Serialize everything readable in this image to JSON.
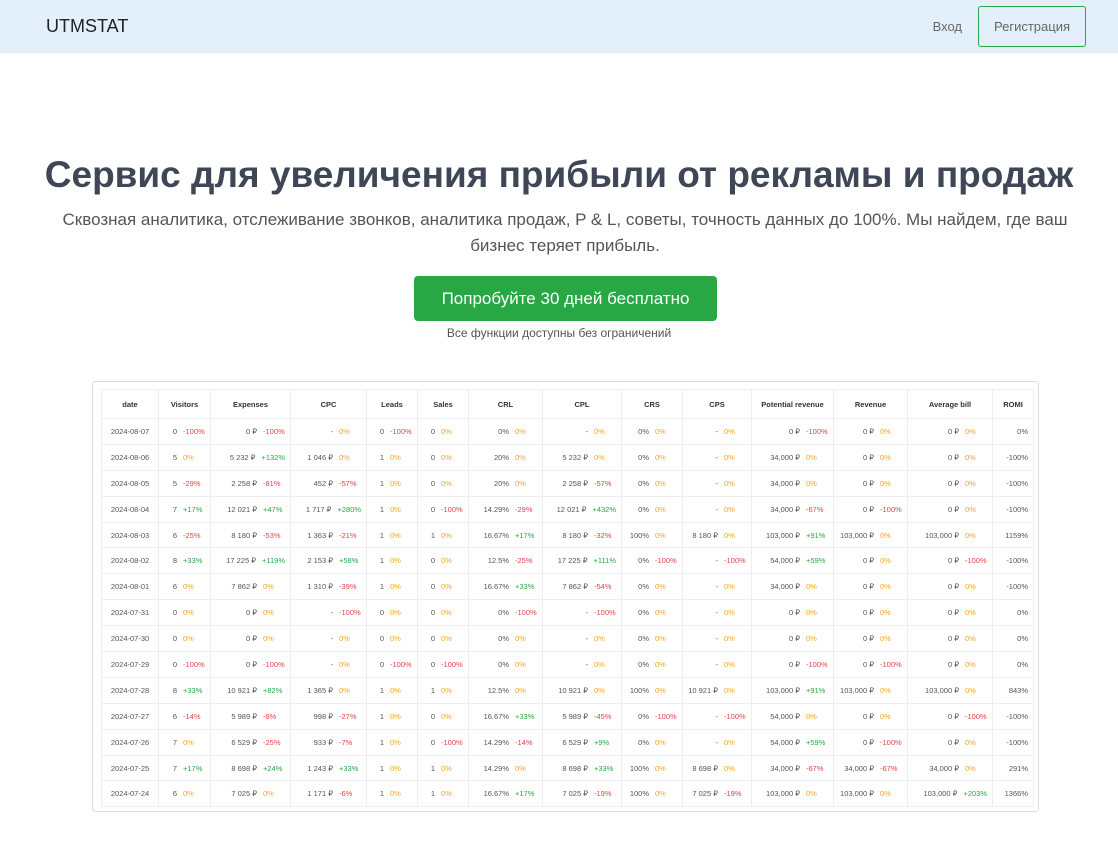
{
  "nav": {
    "brand": "UTMSTAT",
    "login": "Вход",
    "register": "Регистрация"
  },
  "hero": {
    "title": "Сервис для увеличения прибыли от рекламы и продаж",
    "subtitle": "Сквозная аналитика, отслеживание звонков, аналитика продаж, P & L, советы, точность данных до 100%. Мы найдем, где ваш бизнес теряет прибыль.",
    "cta": "Попробуйте 30 дней бесплатно",
    "note": "Все функции доступны без ограничений"
  },
  "colors": {
    "positive": "#28a745",
    "negative": "#e04545",
    "neutral": "#f5a623"
  },
  "table": {
    "columns": [
      "date",
      "Visitors",
      "Expenses",
      "CPC",
      "Leads",
      "Sales",
      "CRL",
      "CPL",
      "CRS",
      "CPS",
      "Potential revenue",
      "Revenue",
      "Average bill",
      "ROMI"
    ],
    "rows": [
      [
        "2024-08-07",
        [
          "0",
          "-100%"
        ],
        [
          "0 ₽",
          "-100%"
        ],
        [
          "-",
          "0%"
        ],
        [
          "0",
          "-100%"
        ],
        [
          "0",
          "0%"
        ],
        [
          "0%",
          "0%"
        ],
        [
          "-",
          "0%"
        ],
        [
          "0%",
          "0%"
        ],
        [
          "-",
          "0%"
        ],
        [
          "0 ₽",
          "-100%"
        ],
        [
          "0 ₽",
          "0%"
        ],
        [
          "0 ₽",
          "0%"
        ],
        "0%"
      ],
      [
        "2024-08-06",
        [
          "5",
          "0%"
        ],
        [
          "5 232 ₽",
          "+132%"
        ],
        [
          "1 046 ₽",
          "0%"
        ],
        [
          "1",
          "0%"
        ],
        [
          "0",
          "0%"
        ],
        [
          "20%",
          "0%"
        ],
        [
          "5 232 ₽",
          "0%"
        ],
        [
          "0%",
          "0%"
        ],
        [
          "-",
          "0%"
        ],
        [
          "34,000 ₽",
          "0%"
        ],
        [
          "0 ₽",
          "0%"
        ],
        [
          "0 ₽",
          "0%"
        ],
        "-100%"
      ],
      [
        "2024-08-05",
        [
          "5",
          "-29%"
        ],
        [
          "2 258 ₽",
          "-81%"
        ],
        [
          "452 ₽",
          "-57%"
        ],
        [
          "1",
          "0%"
        ],
        [
          "0",
          "0%"
        ],
        [
          "20%",
          "0%"
        ],
        [
          "2 258 ₽",
          "-57%"
        ],
        [
          "0%",
          "0%"
        ],
        [
          "-",
          "0%"
        ],
        [
          "34,000 ₽",
          "0%"
        ],
        [
          "0 ₽",
          "0%"
        ],
        [
          "0 ₽",
          "0%"
        ],
        "-100%"
      ],
      [
        "2024-08-04",
        [
          "7",
          "+17%"
        ],
        [
          "12 021 ₽",
          "+47%"
        ],
        [
          "1 717 ₽",
          "+280%"
        ],
        [
          "1",
          "0%"
        ],
        [
          "0",
          "-100%"
        ],
        [
          "14.29%",
          "-29%"
        ],
        [
          "12 021 ₽",
          "+432%"
        ],
        [
          "0%",
          "0%"
        ],
        [
          "-",
          "0%"
        ],
        [
          "34,000 ₽",
          "-67%"
        ],
        [
          "0 ₽",
          "-100%"
        ],
        [
          "0 ₽",
          "0%"
        ],
        "-100%"
      ],
      [
        "2024-08-03",
        [
          "6",
          "-25%"
        ],
        [
          "8 180 ₽",
          "-53%"
        ],
        [
          "1 363 ₽",
          "-21%"
        ],
        [
          "1",
          "0%"
        ],
        [
          "1",
          "0%"
        ],
        [
          "16.67%",
          "+17%"
        ],
        [
          "8 180 ₽",
          "-32%"
        ],
        [
          "100%",
          "0%"
        ],
        [
          "8 180 ₽",
          "0%"
        ],
        [
          "103,000 ₽",
          "+91%"
        ],
        [
          "103,000 ₽",
          "0%"
        ],
        [
          "103,000 ₽",
          "0%"
        ],
        "1159%"
      ],
      [
        "2024-08-02",
        [
          "8",
          "+33%"
        ],
        [
          "17 225 ₽",
          "+119%"
        ],
        [
          "2 153 ₽",
          "+58%"
        ],
        [
          "1",
          "0%"
        ],
        [
          "0",
          "0%"
        ],
        [
          "12.5%",
          "-25%"
        ],
        [
          "17 225 ₽",
          "+111%"
        ],
        [
          "0%",
          "-100%"
        ],
        [
          "-",
          "-100%"
        ],
        [
          "54,000 ₽",
          "+59%"
        ],
        [
          "0 ₽",
          "0%"
        ],
        [
          "0 ₽",
          "-100%"
        ],
        "-100%"
      ],
      [
        "2024-08-01",
        [
          "6",
          "0%"
        ],
        [
          "7 862 ₽",
          "0%"
        ],
        [
          "1 310 ₽",
          "-39%"
        ],
        [
          "1",
          "0%"
        ],
        [
          "0",
          "0%"
        ],
        [
          "16.67%",
          "+33%"
        ],
        [
          "7 862 ₽",
          "-54%"
        ],
        [
          "0%",
          "0%"
        ],
        [
          "-",
          "0%"
        ],
        [
          "34,000 ₽",
          "0%"
        ],
        [
          "0 ₽",
          "0%"
        ],
        [
          "0 ₽",
          "0%"
        ],
        "-100%"
      ],
      [
        "2024-07-31",
        [
          "0",
          "0%"
        ],
        [
          "0 ₽",
          "0%"
        ],
        [
          "-",
          "-100%"
        ],
        [
          "0",
          "0%"
        ],
        [
          "0",
          "0%"
        ],
        [
          "0%",
          "-100%"
        ],
        [
          "-",
          "-100%"
        ],
        [
          "0%",
          "0%"
        ],
        [
          "-",
          "0%"
        ],
        [
          "0 ₽",
          "0%"
        ],
        [
          "0 ₽",
          "0%"
        ],
        [
          "0 ₽",
          "0%"
        ],
        "0%"
      ],
      [
        "2024-07-30",
        [
          "0",
          "0%"
        ],
        [
          "0 ₽",
          "0%"
        ],
        [
          "-",
          "0%"
        ],
        [
          "0",
          "0%"
        ],
        [
          "0",
          "0%"
        ],
        [
          "0%",
          "0%"
        ],
        [
          "-",
          "0%"
        ],
        [
          "0%",
          "0%"
        ],
        [
          "-",
          "0%"
        ],
        [
          "0 ₽",
          "0%"
        ],
        [
          "0 ₽",
          "0%"
        ],
        [
          "0 ₽",
          "0%"
        ],
        "0%"
      ],
      [
        "2024-07-29",
        [
          "0",
          "-100%"
        ],
        [
          "0 ₽",
          "-100%"
        ],
        [
          "-",
          "0%"
        ],
        [
          "0",
          "-100%"
        ],
        [
          "0",
          "-100%"
        ],
        [
          "0%",
          "0%"
        ],
        [
          "-",
          "0%"
        ],
        [
          "0%",
          "0%"
        ],
        [
          "-",
          "0%"
        ],
        [
          "0 ₽",
          "-100%"
        ],
        [
          "0 ₽",
          "-100%"
        ],
        [
          "0 ₽",
          "0%"
        ],
        "0%"
      ],
      [
        "2024-07-28",
        [
          "8",
          "+33%"
        ],
        [
          "10 921 ₽",
          "+82%"
        ],
        [
          "1 365 ₽",
          "0%"
        ],
        [
          "1",
          "0%"
        ],
        [
          "1",
          "0%"
        ],
        [
          "12.5%",
          "0%"
        ],
        [
          "10 921 ₽",
          "0%"
        ],
        [
          "100%",
          "0%"
        ],
        [
          "10 921 ₽",
          "0%"
        ],
        [
          "103,000 ₽",
          "+91%"
        ],
        [
          "103,000 ₽",
          "0%"
        ],
        [
          "103,000 ₽",
          "0%"
        ],
        "843%"
      ],
      [
        "2024-07-27",
        [
          "6",
          "-14%"
        ],
        [
          "5 989 ₽",
          "-8%"
        ],
        [
          "998 ₽",
          "-27%"
        ],
        [
          "1",
          "0%"
        ],
        [
          "0",
          "0%"
        ],
        [
          "16.67%",
          "+33%"
        ],
        [
          "5 989 ₽",
          "-45%"
        ],
        [
          "0%",
          "-100%"
        ],
        [
          "-",
          "-100%"
        ],
        [
          "54,000 ₽",
          "0%"
        ],
        [
          "0 ₽",
          "0%"
        ],
        [
          "0 ₽",
          "-100%"
        ],
        "-100%"
      ],
      [
        "2024-07-26",
        [
          "7",
          "0%"
        ],
        [
          "6 529 ₽",
          "-25%"
        ],
        [
          "933 ₽",
          "-7%"
        ],
        [
          "1",
          "0%"
        ],
        [
          "0",
          "-100%"
        ],
        [
          "14.29%",
          "-14%"
        ],
        [
          "6 529 ₽",
          "+9%"
        ],
        [
          "0%",
          "0%"
        ],
        [
          "-",
          "0%"
        ],
        [
          "54,000 ₽",
          "+59%"
        ],
        [
          "0 ₽",
          "-100%"
        ],
        [
          "0 ₽",
          "0%"
        ],
        "-100%"
      ],
      [
        "2024-07-25",
        [
          "7",
          "+17%"
        ],
        [
          "8 698 ₽",
          "+24%"
        ],
        [
          "1 243 ₽",
          "+33%"
        ],
        [
          "1",
          "0%"
        ],
        [
          "1",
          "0%"
        ],
        [
          "14.29%",
          "0%"
        ],
        [
          "8 698 ₽",
          "+33%"
        ],
        [
          "100%",
          "0%"
        ],
        [
          "8 698 ₽",
          "0%"
        ],
        [
          "34,000 ₽",
          "-67%"
        ],
        [
          "34,000 ₽",
          "-67%"
        ],
        [
          "34,000 ₽",
          "0%"
        ],
        "291%"
      ],
      [
        "2024-07-24",
        [
          "6",
          "0%"
        ],
        [
          "7 025 ₽",
          "0%"
        ],
        [
          "1 171 ₽",
          "-6%"
        ],
        [
          "1",
          "0%"
        ],
        [
          "1",
          "0%"
        ],
        [
          "16.67%",
          "+17%"
        ],
        [
          "7 025 ₽",
          "-19%"
        ],
        [
          "100%",
          "0%"
        ],
        [
          "7 025 ₽",
          "-19%"
        ],
        [
          "103,000 ₽",
          "0%"
        ],
        [
          "103,000 ₽",
          "0%"
        ],
        [
          "103,000 ₽",
          "+203%"
        ],
        "1366%"
      ]
    ]
  }
}
